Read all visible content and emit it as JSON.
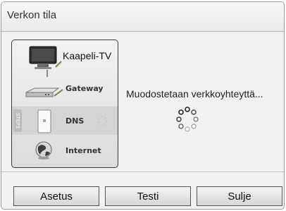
{
  "dialog": {
    "title": "Verkon tila",
    "message": "Muodostetaan verkkoyhteyttä...",
    "steps": [
      {
        "label": "Kaapeli-TV",
        "icon": "tv-icon"
      },
      {
        "label": "Gateway",
        "icon": "gateway-icon"
      },
      {
        "label": "DNS",
        "icon": "dns-icon",
        "badge": "STEP3",
        "active": true
      },
      {
        "label": "Internet",
        "icon": "globe-icon"
      }
    ],
    "buttons": {
      "asetus": "Asetus",
      "testi": "Testi",
      "sulje": "Sulje"
    }
  },
  "colors": {
    "panel_border": "#3a3a3a",
    "spinner_dark": "#222222",
    "spinner_light": "#bbbbbb"
  }
}
